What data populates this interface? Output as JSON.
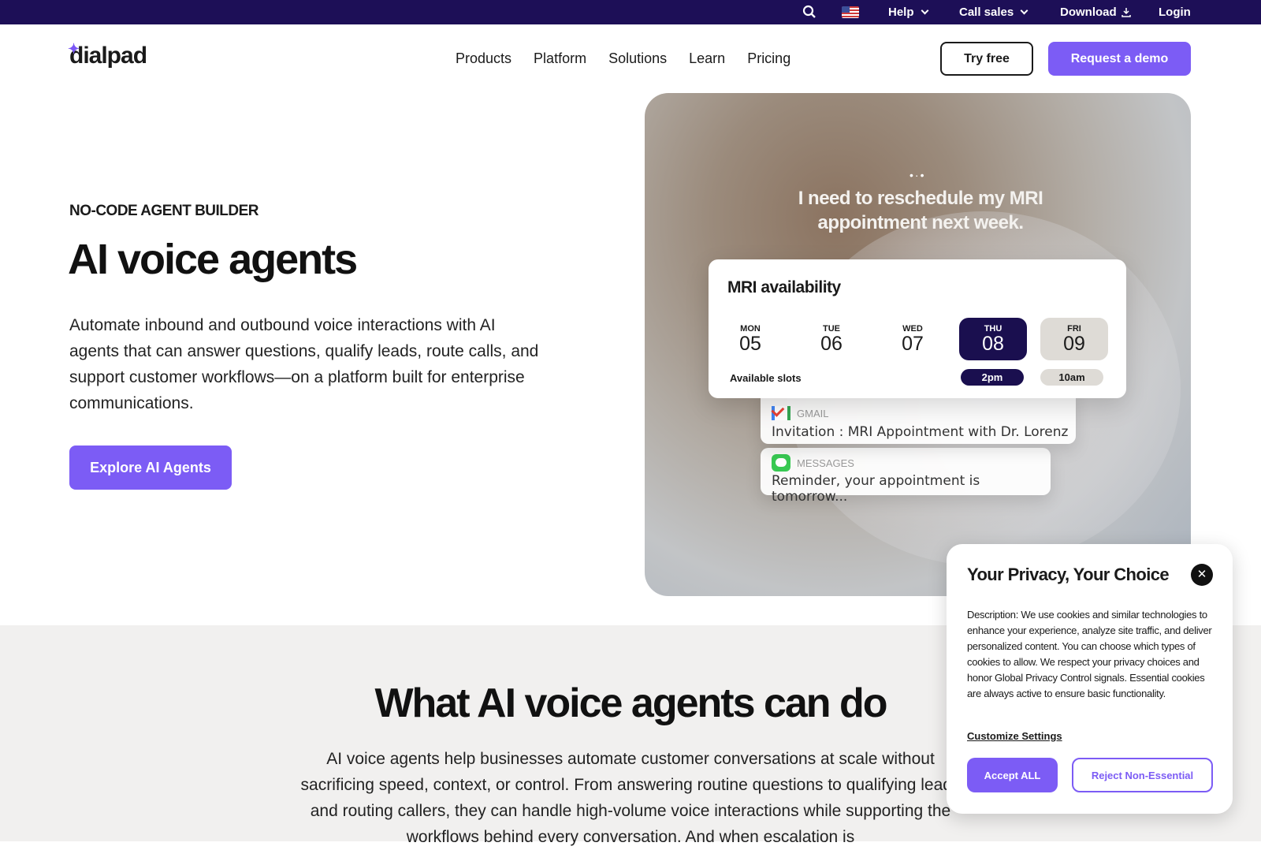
{
  "topbar": {
    "help": "Help",
    "call_sales": "Call sales",
    "download": "Download",
    "login": "Login"
  },
  "nav": {
    "logo": "dialpad",
    "links": [
      "Products",
      "Platform",
      "Solutions",
      "Learn",
      "Pricing"
    ],
    "try_free": "Try free",
    "request_demo": "Request a demo"
  },
  "hero": {
    "eyebrow": "NO-CODE AGENT BUILDER",
    "title": "AI voice agents",
    "lead": "Automate inbound and outbound voice interactions with AI agents that can answer questions, qualify leads, route calls, and support customer workflows—on a platform built for enterprise communications.",
    "cta": "Explore AI Agents"
  },
  "visual": {
    "quote": "I need to reschedule my MRI appointment next week.",
    "calendar": {
      "title": "MRI availability",
      "days": [
        {
          "dow": "MON",
          "date": "05"
        },
        {
          "dow": "TUE",
          "date": "06"
        },
        {
          "dow": "WED",
          "date": "07"
        },
        {
          "dow": "THU",
          "date": "08"
        },
        {
          "dow": "FRI",
          "date": "09"
        }
      ],
      "slots_label": "Available slots",
      "slots": [
        "2pm",
        "10am"
      ]
    },
    "notifications": [
      {
        "app": "GMAIL",
        "message": "Invitation : MRI Appointment with Dr. Lorenz"
      },
      {
        "app": "MESSAGES",
        "message": "Reminder, your appointment is tomorrow..."
      }
    ]
  },
  "section2": {
    "title": "What AI voice agents can do",
    "body": "AI voice agents help businesses automate customer conversations at scale without sacrificing speed, context, or control. From answering routine questions to qualifying leads and routing callers, they can handle high-volume voice interactions while supporting the workflows behind every conversation. And when escalation is"
  },
  "cookie": {
    "title": "Your Privacy, Your Choice",
    "description": "Description: We use cookies and similar technologies to enhance your experience, analyze site traffic, and deliver personalized content. You can choose which types of cookies to allow. We respect your privacy choices and honor Global Privacy Control signals. Essential cookies are always active to ensure basic functionality.",
    "customize": "Customize Settings",
    "accept": "Accept ALL",
    "reject": "Reject Non-Essential"
  },
  "colors": {
    "topbar": "#1d0f57",
    "accent": "#7c5cf5",
    "selected_day": "#1a0f4f"
  }
}
